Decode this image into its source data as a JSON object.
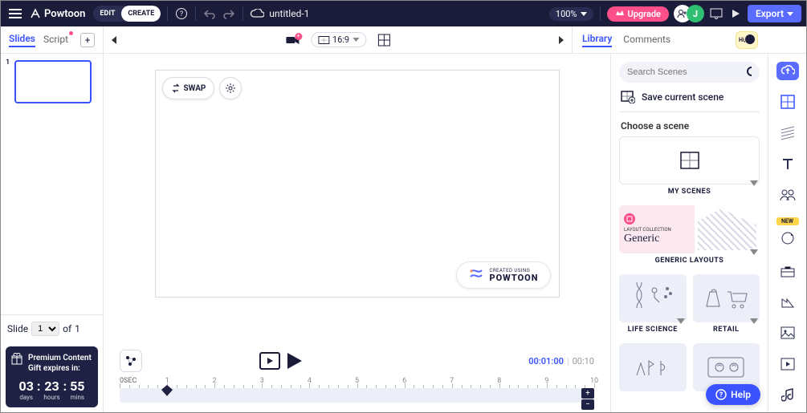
{
  "brand": "Powtoon",
  "mode": {
    "edit": "EDIT",
    "create": "CREATE"
  },
  "doc_title": "untitled-1",
  "zoom": "100%",
  "upgrade": "Upgrade",
  "avatar_initial": "J",
  "export": "Export",
  "secondbar": {
    "slides_tab": "Slides",
    "script_tab": "Script",
    "ratio": "16:9"
  },
  "right_tabs": {
    "library": "Library",
    "comments": "Comments"
  },
  "slide": {
    "label": "Slide",
    "current": "1",
    "of": "of",
    "total": "1"
  },
  "promo": {
    "line1": "Premium Content",
    "line2": "Gift expires in:",
    "days_n": "03",
    "days_l": "days",
    "hours_n": "23",
    "hours_l": "hours",
    "mins_n": "55",
    "mins_l": "mins"
  },
  "stage": {
    "swap": "SWAP",
    "wm_small": "CREATED USING",
    "wm_brand": "POWTOON"
  },
  "playback": {
    "current": "00:01:00",
    "total": "00:10"
  },
  "timeline": {
    "label": "0SEC",
    "marks": [
      "1",
      "2",
      "3",
      "4",
      "5",
      "6",
      "7",
      "8",
      "9",
      "10"
    ]
  },
  "library": {
    "search_placeholder": "Search Scenes",
    "save_scene": "Save current scene",
    "choose": "Choose a scene",
    "my_scenes": "MY SCENES",
    "generic_top": "LAYOUT COLLECTION",
    "generic_big": "Generic",
    "generic_label": "GENERIC LAYOUTS",
    "life": "LIFE SCIENCE",
    "retail": "RETAIL",
    "new_badge": "NEW"
  },
  "help": "Help"
}
